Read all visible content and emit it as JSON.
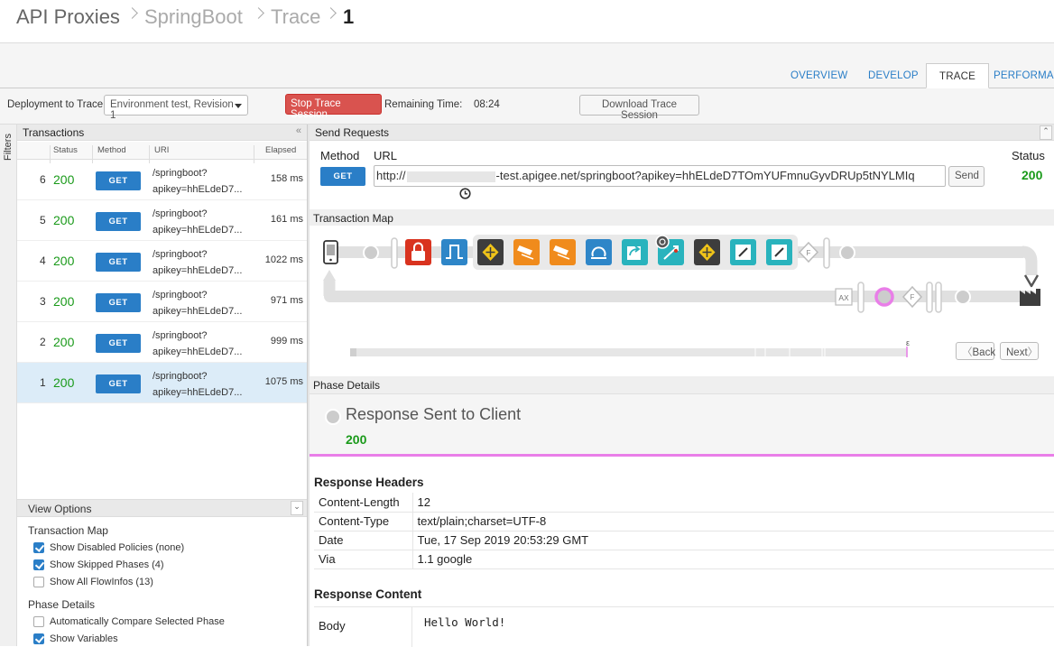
{
  "breadcrumb": {
    "items": [
      "API Proxies",
      "SpringBoot",
      "Trace",
      "1"
    ]
  },
  "tabs": [
    "OVERVIEW",
    "DEVELOP",
    "TRACE",
    "PERFORMAN"
  ],
  "toolbar": {
    "deploy_label": "Deployment to Trace",
    "deploy_value": "Environment test, Revision 1",
    "stop_label": "Stop Trace Session",
    "remaining_label": "Remaining Time:",
    "remaining_value": "08:24",
    "download_label": "Download Trace Session"
  },
  "filters_label": "Filters",
  "transactions": {
    "title": "Transactions",
    "columns": [
      "Status",
      "Method",
      "URI",
      "Elapsed"
    ],
    "rows": [
      {
        "idx": "6",
        "status": "200",
        "method": "GET",
        "uri1": "/springboot?",
        "uri2": "apikey=hhELdeD7...",
        "elapsed": "158 ms"
      },
      {
        "idx": "5",
        "status": "200",
        "method": "GET",
        "uri1": "/springboot?",
        "uri2": "apikey=hhELdeD7...",
        "elapsed": "161 ms"
      },
      {
        "idx": "4",
        "status": "200",
        "method": "GET",
        "uri1": "/springboot?",
        "uri2": "apikey=hhELdeD7...",
        "elapsed": "1022 ms"
      },
      {
        "idx": "3",
        "status": "200",
        "method": "GET",
        "uri1": "/springboot?",
        "uri2": "apikey=hhELdeD7...",
        "elapsed": "971 ms"
      },
      {
        "idx": "2",
        "status": "200",
        "method": "GET",
        "uri1": "/springboot?",
        "uri2": "apikey=hhELdeD7...",
        "elapsed": "999 ms"
      },
      {
        "idx": "1",
        "status": "200",
        "method": "GET",
        "uri1": "/springboot?",
        "uri2": "apikey=hhELdeD7...",
        "elapsed": "1075 ms"
      }
    ]
  },
  "view_options": {
    "title": "View Options",
    "map_section": "Transaction Map",
    "map_options": [
      "Show Disabled Policies (none)",
      "Show Skipped Phases (4)",
      "Show All FlowInfos (13)"
    ],
    "phase_section": "Phase Details",
    "phase_options": [
      "Automatically Compare Selected Phase",
      "Show Variables"
    ]
  },
  "send_requests": {
    "title": "Send Requests",
    "method_label": "Method",
    "url_label": "URL",
    "status_label": "Status",
    "method": "GET",
    "url_prefix": "http://",
    "url_suffix": "-test.apigee.net/springboot?apikey=hhELdeD7TOmYUFmnuGyvDRUp5tNYLMIq",
    "send_label": "Send",
    "status_value": "200"
  },
  "transaction_map": {
    "title": "Transaction Map",
    "flowinfo_letter": "F",
    "analytics_label": "AX",
    "end_marker": "ε",
    "back_label": "Back",
    "next_label": "Next"
  },
  "phase_details": {
    "title": "Phase Details",
    "phase_name": "Response Sent to Client",
    "phase_status": "200"
  },
  "response_headers": {
    "title": "Response Headers",
    "rows": [
      {
        "name": "Content-Length",
        "value": "12"
      },
      {
        "name": "Content-Type",
        "value": "text/plain;charset=UTF-8"
      },
      {
        "name": "Date",
        "value": "Tue, 17 Sep 2019 20:53:29 GMT"
      },
      {
        "name": "Via",
        "value": "1.1 google"
      }
    ]
  },
  "response_content": {
    "title": "Response Content",
    "body_label": "Body",
    "body_value": "Hello World!"
  },
  "colors": {
    "accent": "#2a7ec7",
    "success": "#1a9a1a",
    "danger": "#d9534f",
    "phase_marker": "#e97ee8"
  }
}
